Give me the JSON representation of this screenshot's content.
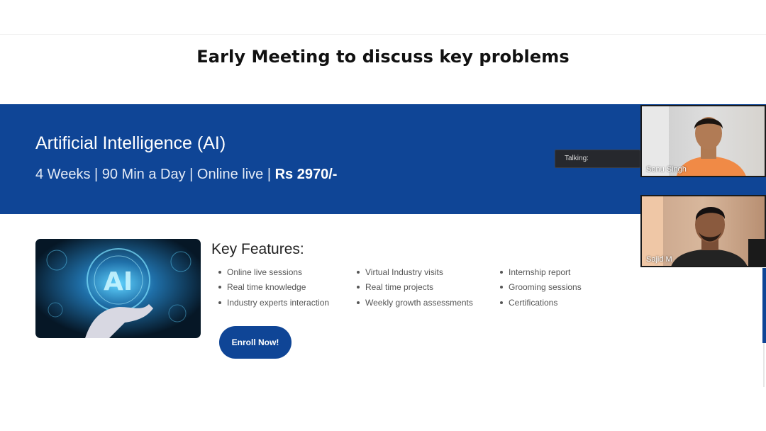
{
  "slide": {
    "title": "Early Meeting to discuss key problems"
  },
  "course": {
    "title": "Artificial Intelligence (AI)",
    "meta": "4 Weeks | 90 Min a Day | Online live | ",
    "price": "Rs 2970/-",
    "image_icon": "ai-hand-hologram-image",
    "banner_color": "#0f4596"
  },
  "features": {
    "heading": "Key Features:",
    "columns": [
      [
        "Online live sessions",
        "Real time knowledge",
        "Industry experts interaction"
      ],
      [
        "Virtual Industry visits",
        "Real time projects",
        "Weekly growth assessments"
      ],
      [
        "Internship report",
        "Grooming sessions",
        "Certifications"
      ]
    ]
  },
  "enroll": {
    "label": "Enroll Now!"
  },
  "meeting": {
    "talking_label": "Talking:",
    "participants": [
      {
        "name": "Sonu Singh"
      },
      {
        "name": "Sajid M"
      }
    ]
  }
}
